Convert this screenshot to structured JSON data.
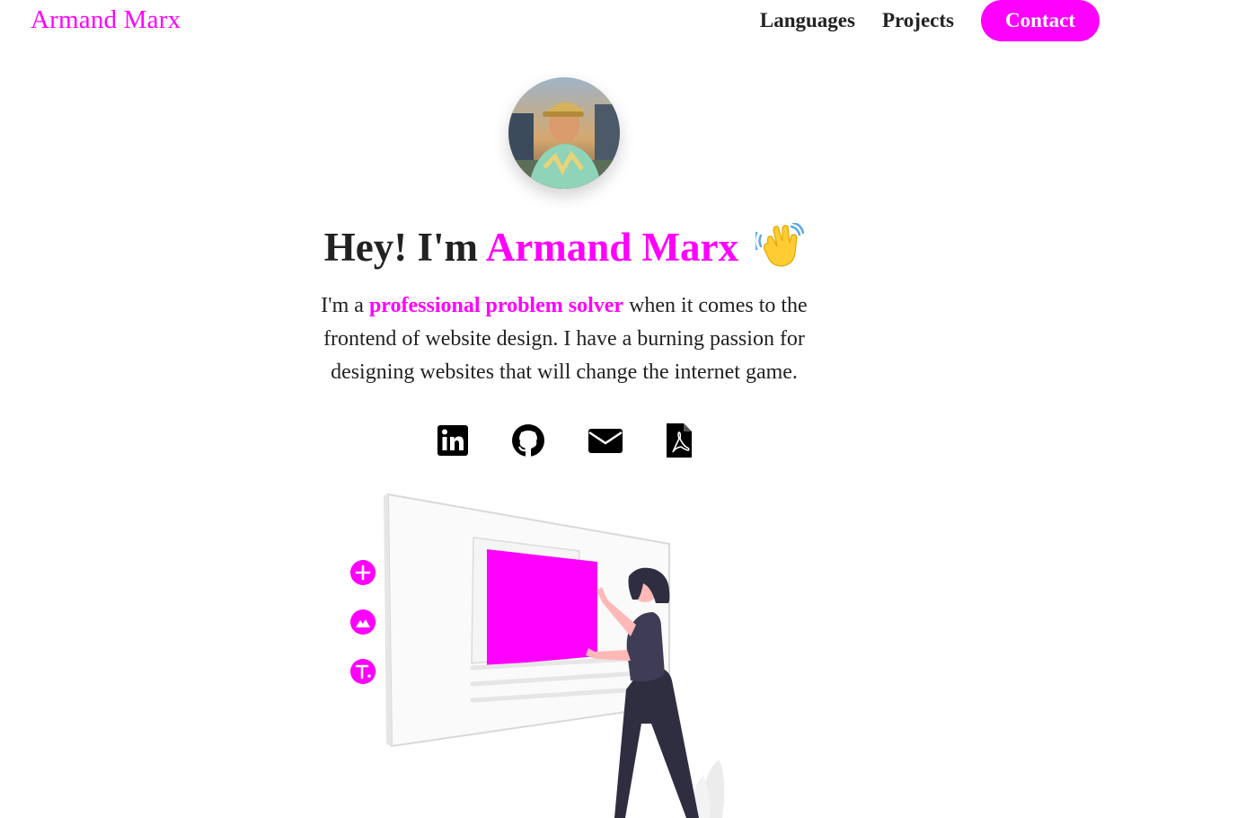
{
  "header": {
    "brand": "Armand Marx",
    "nav": [
      {
        "label": "Languages"
      },
      {
        "label": "Projects"
      }
    ],
    "contact_label": "Contact"
  },
  "hero": {
    "headline_prefix": "Hey! I'm ",
    "headline_name": "Armand Marx",
    "wave_icon": "waving-hand-emoji",
    "bio_prefix": "I'm a ",
    "bio_highlight": "professional problem solver",
    "bio_suffix": " when it comes to the frontend of website design. I have a burning passion for designing websites that will change the internet game."
  },
  "socials": [
    {
      "icon": "linkedin-icon"
    },
    {
      "icon": "github-icon"
    },
    {
      "icon": "mail-icon"
    },
    {
      "icon": "pdf-icon"
    }
  ],
  "colors": {
    "accent": "#ff00ff",
    "text": "#222222",
    "figure_dark": "#2f2e41",
    "skin": "#ffb8b8"
  }
}
